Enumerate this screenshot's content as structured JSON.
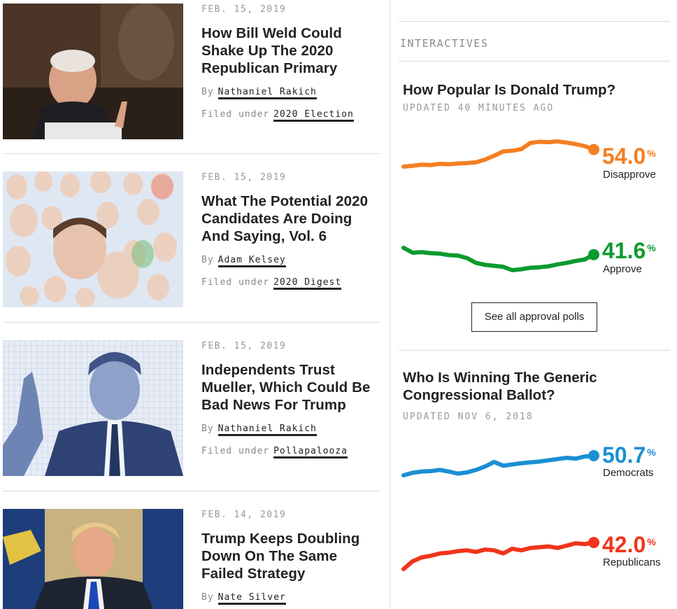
{
  "stories": [
    {
      "date": "FEB. 15, 2019",
      "headline": "How Bill Weld Could Shake Up The 2020 Republican Primary",
      "by_prefix": "By",
      "author": "Nathaniel Rakich",
      "filed_prefix": "Filed under",
      "filed": "2020 Election"
    },
    {
      "date": "FEB. 15, 2019",
      "headline": "What The Potential 2020 Candidates Are Doing And Saying, Vol. 6",
      "by_prefix": "By",
      "author": "Adam Kelsey",
      "filed_prefix": "Filed under",
      "filed": "2020 Digest"
    },
    {
      "date": "FEB. 15, 2019",
      "headline": "Independents Trust Mueller, Which Could Be Bad News For Trump",
      "by_prefix": "By",
      "author": "Nathaniel Rakich",
      "filed_prefix": "Filed under",
      "filed": "Pollapalooza"
    },
    {
      "date": "FEB. 14, 2019",
      "headline": "Trump Keeps Doubling Down On The Same Failed Strategy",
      "by_prefix": "By",
      "author": "Nate Silver"
    }
  ],
  "sidebar": {
    "section_label": "INTERACTIVES",
    "approval": {
      "title": "How Popular Is Donald Trump?",
      "updated": "UPDATED 40 MINUTES AGO",
      "disapprove_value": "54.0",
      "disapprove_label": "Disapprove",
      "approve_value": "41.6",
      "approve_label": "Approve",
      "pct": "%",
      "button": "See all approval polls"
    },
    "generic": {
      "title": "Who Is Winning The Generic Congressional Ballot?",
      "updated": "UPDATED NOV 6, 2018",
      "dem_value": "50.7",
      "dem_label": "Democrats",
      "rep_value": "42.0",
      "rep_label": "Republicans",
      "pct": "%"
    }
  },
  "colors": {
    "disapprove": "#f57f22",
    "approve": "#0c9b2d",
    "democrats": "#1a8fd3",
    "republicans": "#f2341b"
  },
  "chart_data": [
    {
      "type": "line",
      "series": [
        {
          "name": "Disapprove",
          "end_value": 54.0,
          "values": [
            49.6,
            49.8,
            50.1,
            50.0,
            50.3,
            50.2,
            50.4,
            50.5,
            50.7,
            51.4,
            52.4,
            53.5,
            53.7,
            54.1,
            55.7,
            56.0,
            55.9,
            56.1,
            55.8,
            55.4,
            54.9,
            54.0
          ]
        },
        {
          "name": "Approve",
          "end_value": 41.6,
          "values": [
            43.0,
            42.0,
            42.1,
            41.9,
            41.8,
            41.5,
            41.4,
            40.9,
            39.9,
            39.5,
            39.3,
            39.1,
            38.4,
            38.6,
            38.9,
            39.0,
            39.2,
            39.6,
            39.9,
            40.3,
            40.6,
            41.6
          ]
        }
      ]
    },
    {
      "type": "line",
      "series": [
        {
          "name": "Democrats",
          "end_value": 50.7,
          "values": [
            46.0,
            46.6,
            46.9,
            47.0,
            47.3,
            46.9,
            46.4,
            46.7,
            47.3,
            48.1,
            49.2,
            48.3,
            48.6,
            48.9,
            49.1,
            49.3,
            49.6,
            49.9,
            50.2,
            50.0,
            50.5,
            50.7
          ]
        },
        {
          "name": "Republicans",
          "end_value": 42.0,
          "values": [
            38.6,
            39.6,
            40.1,
            40.3,
            40.6,
            40.7,
            40.9,
            41.0,
            40.8,
            41.1,
            41.0,
            40.6,
            41.2,
            41.0,
            41.3,
            41.4,
            41.5,
            41.3,
            41.6,
            41.9,
            41.8,
            42.0
          ]
        }
      ]
    }
  ]
}
